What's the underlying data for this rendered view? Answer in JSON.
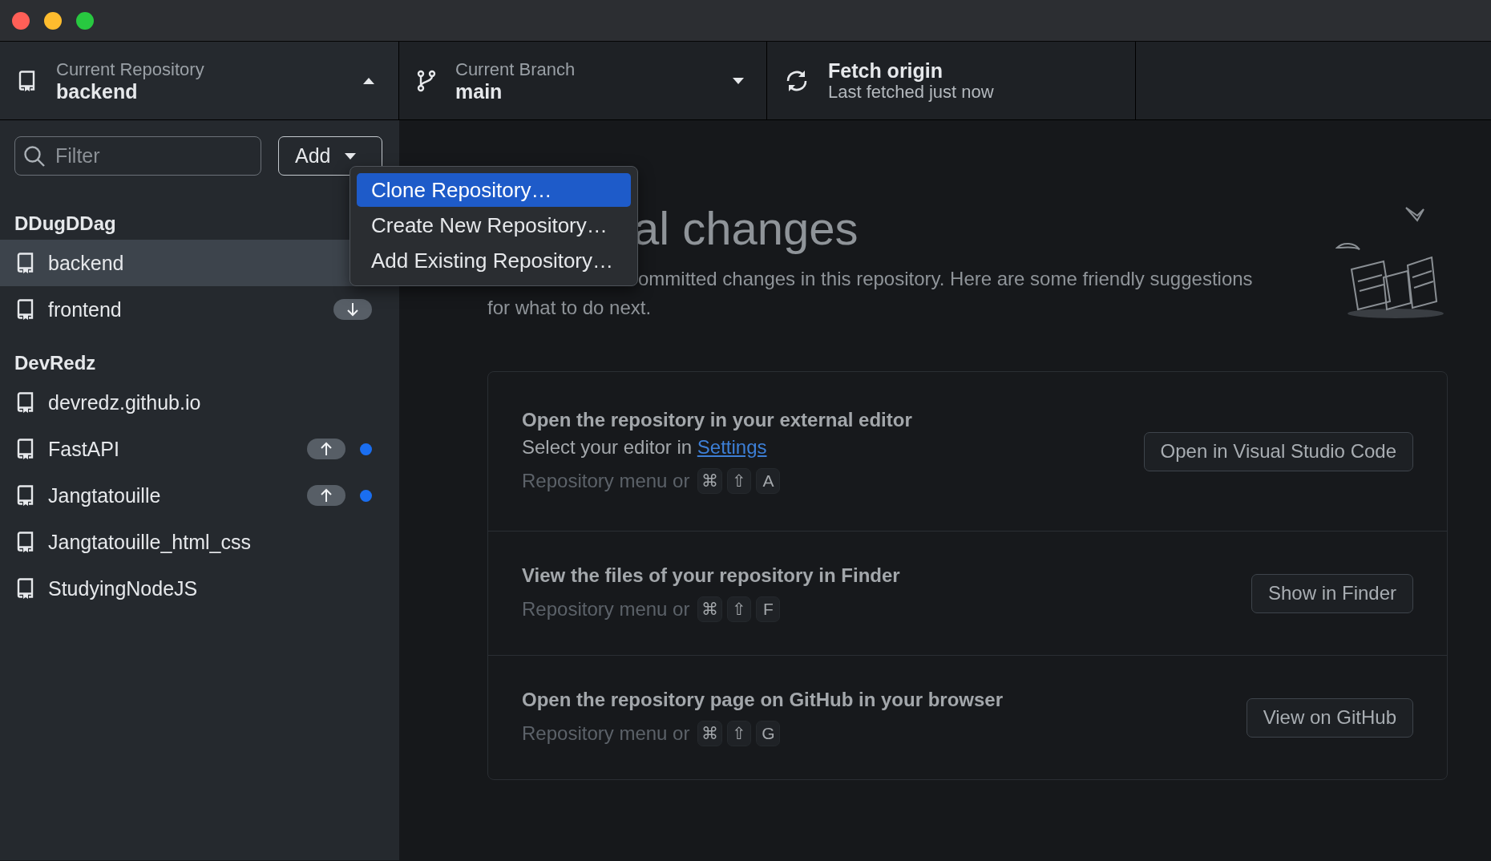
{
  "toolbar": {
    "repository": {
      "label": "Current Repository",
      "value": "backend",
      "expanded": true
    },
    "branch": {
      "label": "Current Branch",
      "value": "main",
      "expanded": false
    },
    "fetch": {
      "title": "Fetch origin",
      "subtitle": "Last fetched just now"
    }
  },
  "sidebar": {
    "filter": {
      "placeholder": "Filter"
    },
    "add_button": "Add",
    "groups": [
      {
        "name": "DDugDDag",
        "repos": [
          {
            "name": "backend",
            "selected": true,
            "ahead": false,
            "behind": false,
            "changed": false
          },
          {
            "name": "frontend",
            "selected": false,
            "ahead": false,
            "behind": true,
            "changed": false
          }
        ]
      },
      {
        "name": "DevRedz",
        "repos": [
          {
            "name": "devredz.github.io",
            "selected": false,
            "ahead": false,
            "behind": false,
            "changed": false
          },
          {
            "name": "FastAPI",
            "selected": false,
            "ahead": true,
            "behind": false,
            "changed": true
          },
          {
            "name": "Jangtatouille",
            "selected": false,
            "ahead": true,
            "behind": false,
            "changed": true
          },
          {
            "name": "Jangtatouille_html_css",
            "selected": false,
            "ahead": false,
            "behind": false,
            "changed": false
          },
          {
            "name": "StudyingNodeJS",
            "selected": false,
            "ahead": false,
            "behind": false,
            "changed": false
          }
        ]
      }
    ]
  },
  "menu": {
    "items": [
      {
        "label": "Clone Repository…",
        "selected": true
      },
      {
        "label": "Create New Repository…",
        "selected": false
      },
      {
        "label": "Add Existing Repository…",
        "selected": false
      }
    ]
  },
  "main": {
    "heading": "al changes",
    "description": [
      "ommitted changes in this repository. Here are some friendly suggestions",
      "for what to do next."
    ],
    "suggestions": [
      {
        "title": "Open the repository in your external editor",
        "detail": "Select your editor in ",
        "link": "Settings",
        "shortcut_prefix": "Repository menu or",
        "keys": [
          "⌘",
          "⇧",
          "A"
        ],
        "button": "Open in Visual Studio Code"
      },
      {
        "title": "View the files of your repository in Finder",
        "shortcut_prefix": "Repository menu or",
        "keys": [
          "⌘",
          "⇧",
          "F"
        ],
        "button": "Show in Finder"
      },
      {
        "title": "Open the repository page on GitHub in your browser",
        "shortcut_prefix": "Repository menu or",
        "keys": [
          "⌘",
          "⇧",
          "G"
        ],
        "button": "View on GitHub"
      }
    ]
  }
}
